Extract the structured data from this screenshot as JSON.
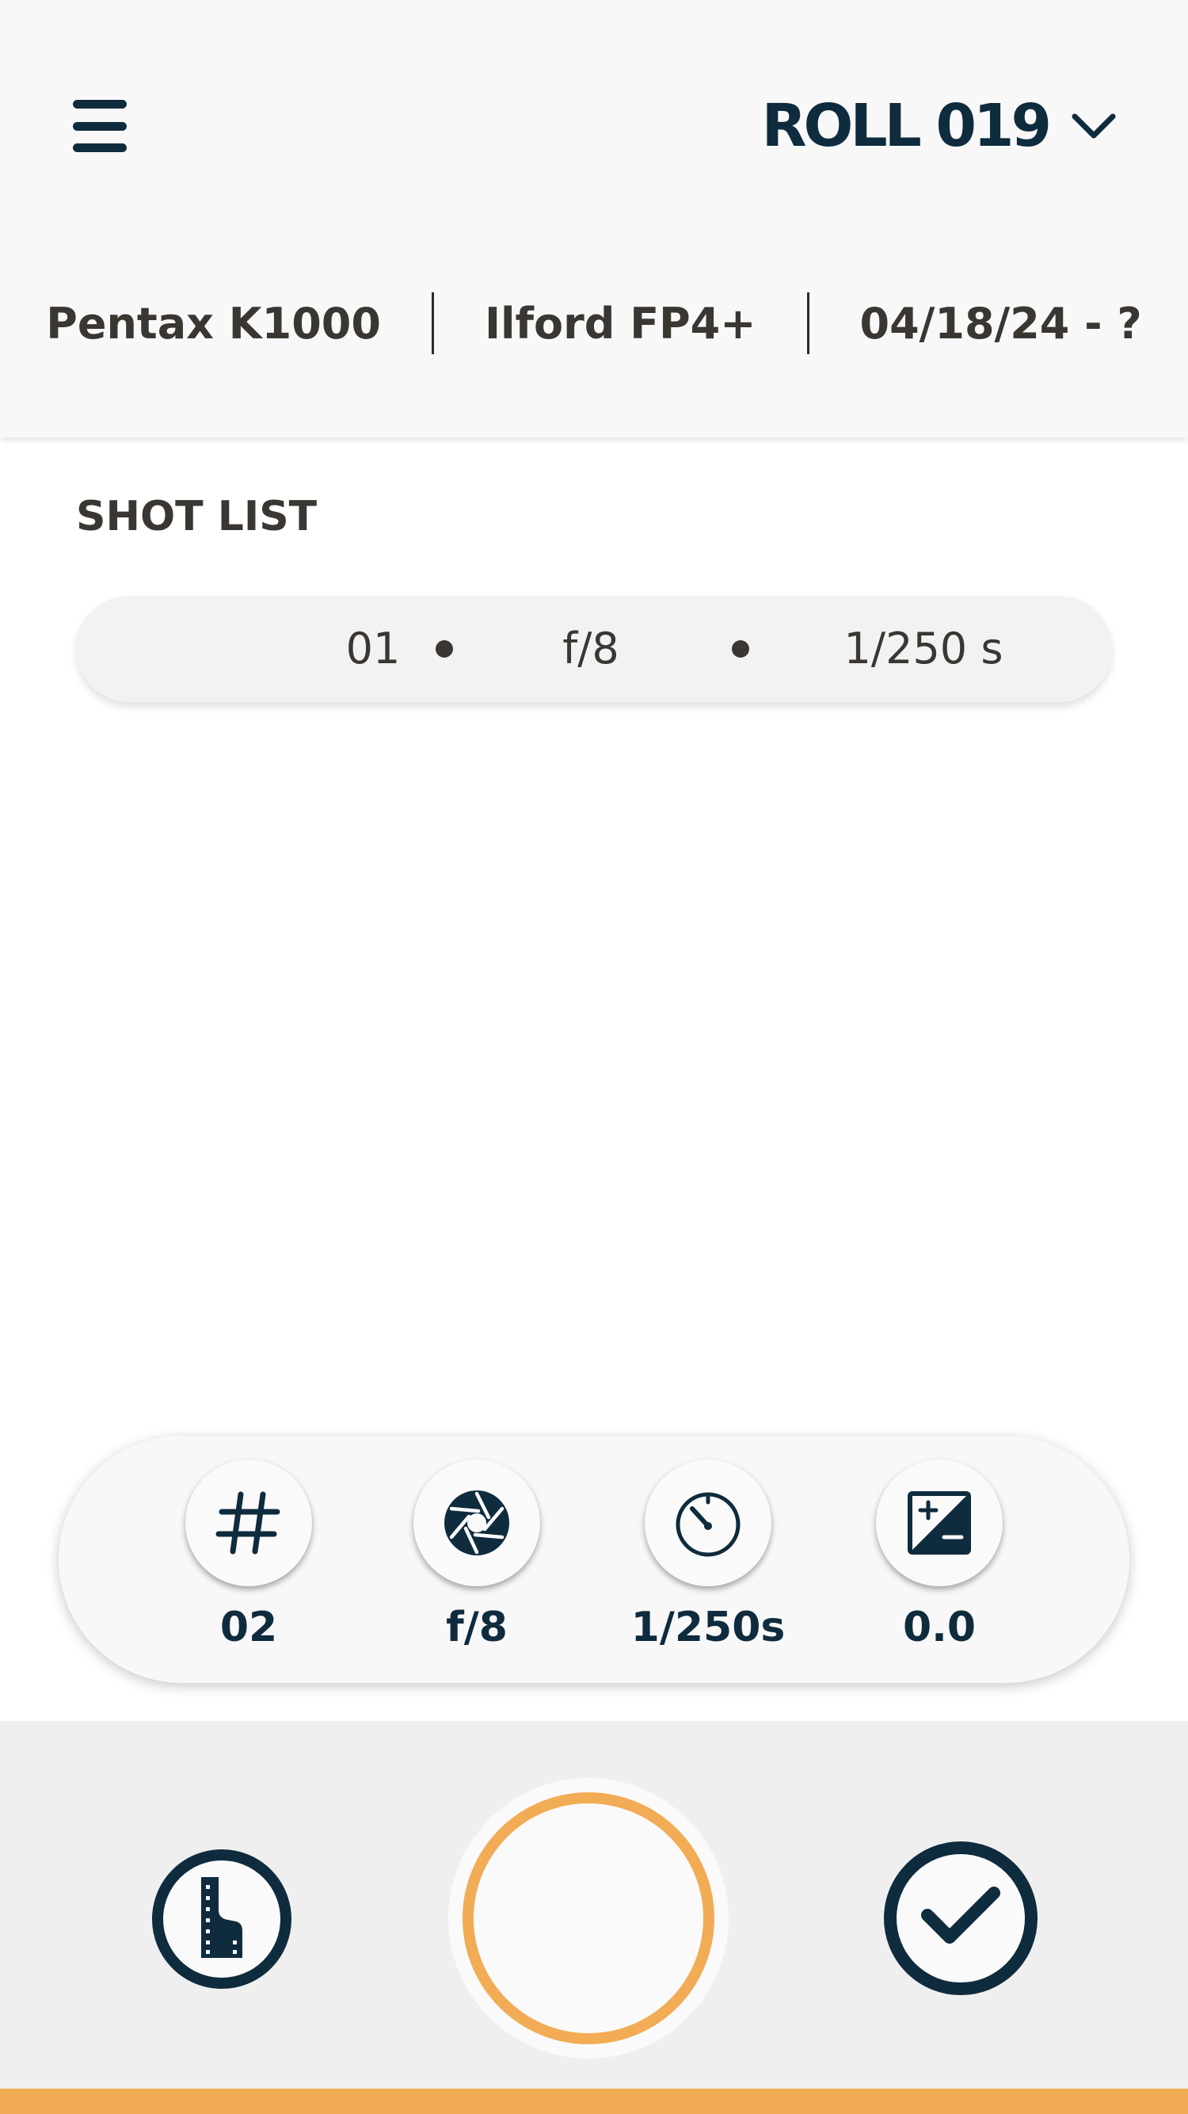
{
  "header": {
    "roll_title": "ROLL 019",
    "camera": "Pentax K1000",
    "film": "Ilford FP4+",
    "dates": "04/18/24 - ?"
  },
  "shot_list": {
    "label": "SHOT LIST",
    "shots": [
      {
        "number": "01",
        "aperture": "f/8",
        "shutter": "1/250 s"
      }
    ]
  },
  "settings": {
    "frame": {
      "icon": "hash-icon",
      "value": "02"
    },
    "aperture": {
      "icon": "aperture-icon",
      "value": "f/8"
    },
    "shutter": {
      "icon": "stopwatch-icon",
      "value": "1/250s"
    },
    "exposure_comp": {
      "icon": "exposure-compensation-icon",
      "value": "0.0"
    }
  },
  "actions": {
    "reload_icon": "film-canister-icon",
    "shutter_icon": "shutter-button",
    "finish_icon": "checkmark-icon"
  },
  "colors": {
    "navy": "#0f2b3e",
    "accent_orange": "#f2ac55",
    "text_dark": "#3a3631",
    "header_bg": "#f8f8f8",
    "action_bar_bg": "#efefef"
  }
}
